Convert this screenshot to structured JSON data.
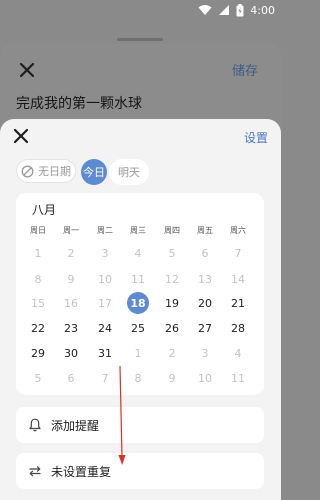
{
  "status_bar": {
    "time": "4:00"
  },
  "background_sheet": {
    "save_label": "储存",
    "task_title": "完成我的第一颗水球"
  },
  "date_sheet": {
    "settings_label": "设置",
    "chips": {
      "no_date": "无日期",
      "today": "今日",
      "tomorrow": "明天"
    },
    "calendar": {
      "month": "八月",
      "weekdays": [
        "周日",
        "周一",
        "周二",
        "周三",
        "周四",
        "周五",
        "周六"
      ],
      "weeks": [
        [
          {
            "d": "1",
            "m": true
          },
          {
            "d": "2",
            "m": true
          },
          {
            "d": "3",
            "m": true
          },
          {
            "d": "4",
            "m": true
          },
          {
            "d": "5",
            "m": true
          },
          {
            "d": "6",
            "m": true
          },
          {
            "d": "7",
            "m": true
          }
        ],
        [
          {
            "d": "8",
            "m": true
          },
          {
            "d": "9",
            "m": true
          },
          {
            "d": "10",
            "m": true
          },
          {
            "d": "11",
            "m": true
          },
          {
            "d": "12",
            "m": true
          },
          {
            "d": "13",
            "m": true
          },
          {
            "d": "14",
            "m": true
          }
        ],
        [
          {
            "d": "15",
            "m": true
          },
          {
            "d": "16",
            "m": true
          },
          {
            "d": "17",
            "m": true
          },
          {
            "d": "18",
            "s": true
          },
          {
            "d": "19"
          },
          {
            "d": "20"
          },
          {
            "d": "21"
          }
        ],
        [
          {
            "d": "22"
          },
          {
            "d": "23"
          },
          {
            "d": "24"
          },
          {
            "d": "25"
          },
          {
            "d": "26"
          },
          {
            "d": "27"
          },
          {
            "d": "28"
          }
        ],
        [
          {
            "d": "29"
          },
          {
            "d": "30"
          },
          {
            "d": "31"
          },
          {
            "d": "1",
            "m": true
          },
          {
            "d": "2",
            "m": true
          },
          {
            "d": "3",
            "m": true
          },
          {
            "d": "4",
            "m": true
          }
        ],
        [
          {
            "d": "5",
            "m": true
          },
          {
            "d": "6",
            "m": true
          },
          {
            "d": "7",
            "m": true
          },
          {
            "d": "8",
            "m": true
          },
          {
            "d": "9",
            "m": true
          },
          {
            "d": "10",
            "m": true
          },
          {
            "d": "11",
            "m": true
          }
        ]
      ],
      "selected_date": "18"
    },
    "reminder_label": "添加提醒",
    "repeat_label": "未设置重复"
  },
  "colors": {
    "accent": "#5e8ad1",
    "annotation_arrow": "#d9322b"
  },
  "icons": {
    "close": "close-icon",
    "no_date": "no-date-icon",
    "bell": "bell-icon",
    "repeat": "repeat-icon"
  }
}
